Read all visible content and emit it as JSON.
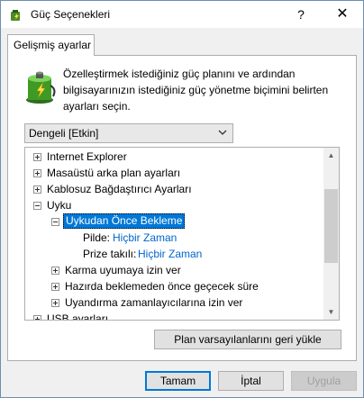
{
  "window": {
    "title": "Güç Seçenekleri",
    "help_label": "?",
    "close_label": "✕"
  },
  "tab": {
    "label": "Gelişmiş ayarlar"
  },
  "description": "Özelleştirmek istediğiniz güç planını ve ardından bilgisayarınızın istediğiniz güç yönetme biçimini belirten ayarları seçin.",
  "plan_select": {
    "value": "Dengeli [Etkin]"
  },
  "tree": {
    "items": [
      {
        "label": "Internet Explorer"
      },
      {
        "label": "Masaüstü arka plan ayarları"
      },
      {
        "label": "Kablosuz Bağdaştırıcı Ayarları"
      },
      {
        "label": "Uyku"
      },
      {
        "label": "Uykudan Önce Bekleme"
      },
      {
        "label": "Pilde:",
        "value": "Hiçbir Zaman"
      },
      {
        "label": "Prize takılı:",
        "value": "Hiçbir Zaman"
      },
      {
        "label": "Karma uyumaya izin ver"
      },
      {
        "label": "Hazırda beklemeden önce geçecek süre"
      },
      {
        "label": "Uyandırma zamanlayıcılarına izin ver"
      },
      {
        "label": "USB ayarları"
      }
    ]
  },
  "buttons": {
    "restore": "Plan varsayılanlarını geri yükle",
    "ok": "Tamam",
    "cancel": "İptal",
    "apply": "Uygula"
  },
  "colors": {
    "selection": "#0078d7",
    "link": "#0066cc"
  }
}
